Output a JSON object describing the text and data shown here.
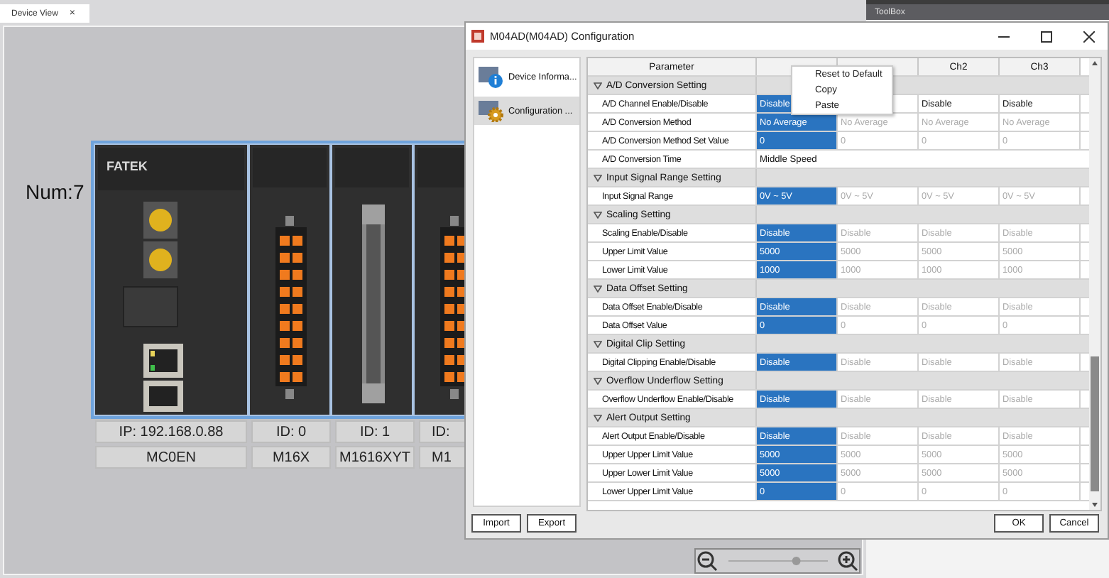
{
  "document_tab": {
    "label": "Device View",
    "close": "×"
  },
  "toolbox": {
    "title": "ToolBox"
  },
  "zoom": {
    "level": 0.7
  },
  "canvas": {
    "count_label": "Num:7",
    "modules": [
      {
        "kind": "cpu",
        "logo": "FATEK",
        "address": "IP: 192.168.0.88",
        "name": "MC0EN"
      },
      {
        "kind": "terminal",
        "address": "ID:  0",
        "name": "M16X"
      },
      {
        "kind": "connector",
        "address": "ID:  1",
        "name": "M1616XYT"
      },
      {
        "kind": "terminal",
        "address": "ID:",
        "name": "M1"
      }
    ]
  },
  "dialog": {
    "title": "M04AD(M04AD) Configuration",
    "nav": [
      {
        "label": "Device Informa...",
        "selected": false
      },
      {
        "label": "Configuration ...",
        "selected": true
      }
    ],
    "columns": [
      {
        "label": "Parameter"
      },
      {},
      {},
      {
        "label": "Ch2"
      },
      {
        "label": "Ch3"
      }
    ],
    "rows": [
      {
        "kind": "section",
        "label": "A/D Conversion Setting",
        "expanded": true
      },
      {
        "kind": "param",
        "label": "A/D Channel Enable/Disable",
        "cells": [
          {
            "text": "Disable",
            "selected": true,
            "disabled": false
          },
          {
            "selected": false
          },
          {
            "text": "Disable",
            "selected": false,
            "disabled": false
          },
          {
            "text": "Disable",
            "selected": false,
            "disabled": false
          }
        ]
      },
      {
        "kind": "param",
        "label": "A/D Conversion Method",
        "cells": [
          {
            "text": "No Average",
            "selected": true,
            "disabled": false
          },
          {
            "text": "No Average",
            "selected": false,
            "disabled": true
          },
          {
            "text": "No Average",
            "selected": false,
            "disabled": true
          },
          {
            "text": "No Average",
            "selected": false,
            "disabled": true
          }
        ]
      },
      {
        "kind": "param",
        "label": "A/D Conversion Method Set Value",
        "cells": [
          {
            "text": "0",
            "selected": true,
            "disabled": false
          },
          {
            "text": "0",
            "selected": false,
            "disabled": true
          },
          {
            "text": "0",
            "selected": false,
            "disabled": true
          },
          {
            "text": "0",
            "selected": false,
            "disabled": true
          }
        ]
      },
      {
        "kind": "span",
        "label": "A/D Conversion Time",
        "value": "Middle Speed"
      },
      {
        "kind": "section",
        "label": "Input Signal Range Setting",
        "expanded": true
      },
      {
        "kind": "param",
        "label": "Input Signal Range",
        "cells": [
          {
            "text": "0V ~ 5V",
            "selected": true,
            "disabled": false
          },
          {
            "text": "0V ~ 5V",
            "selected": false,
            "disabled": true
          },
          {
            "text": "0V ~ 5V",
            "selected": false,
            "disabled": true
          },
          {
            "text": "0V ~ 5V",
            "selected": false,
            "disabled": true
          }
        ]
      },
      {
        "kind": "section",
        "label": "Scaling Setting",
        "expanded": true
      },
      {
        "kind": "param",
        "label": "Scaling Enable/Disable",
        "cells": [
          {
            "text": "Disable",
            "selected": true,
            "disabled": false
          },
          {
            "text": "Disable",
            "selected": false,
            "disabled": true
          },
          {
            "text": "Disable",
            "selected": false,
            "disabled": true
          },
          {
            "text": "Disable",
            "selected": false,
            "disabled": true
          }
        ]
      },
      {
        "kind": "param",
        "label": "Upper Limit Value",
        "cells": [
          {
            "text": "5000",
            "selected": true,
            "disabled": false
          },
          {
            "text": "5000",
            "selected": false,
            "disabled": true
          },
          {
            "text": "5000",
            "selected": false,
            "disabled": true
          },
          {
            "text": "5000",
            "selected": false,
            "disabled": true
          }
        ]
      },
      {
        "kind": "param",
        "label": "Lower Limit Value",
        "cells": [
          {
            "text": "1000",
            "selected": true,
            "disabled": false
          },
          {
            "text": "1000",
            "selected": false,
            "disabled": true
          },
          {
            "text": "1000",
            "selected": false,
            "disabled": true
          },
          {
            "text": "1000",
            "selected": false,
            "disabled": true
          }
        ]
      },
      {
        "kind": "section",
        "label": "Data Offset Setting",
        "expanded": true
      },
      {
        "kind": "param",
        "label": "Data Offset Enable/Disable",
        "cells": [
          {
            "text": "Disable",
            "selected": true,
            "disabled": false
          },
          {
            "text": "Disable",
            "selected": false,
            "disabled": true
          },
          {
            "text": "Disable",
            "selected": false,
            "disabled": true
          },
          {
            "text": "Disable",
            "selected": false,
            "disabled": true
          }
        ]
      },
      {
        "kind": "param",
        "label": "Data Offset Value",
        "cells": [
          {
            "text": "0",
            "selected": true,
            "disabled": false
          },
          {
            "text": "0",
            "selected": false,
            "disabled": true
          },
          {
            "text": "0",
            "selected": false,
            "disabled": true
          },
          {
            "text": "0",
            "selected": false,
            "disabled": true
          }
        ]
      },
      {
        "kind": "section",
        "label": "Digital Clip Setting",
        "expanded": true
      },
      {
        "kind": "param",
        "label": "Digital Clipping Enable/Disable",
        "cells": [
          {
            "text": "Disable",
            "selected": true,
            "disabled": false
          },
          {
            "text": "Disable",
            "selected": false,
            "disabled": true
          },
          {
            "text": "Disable",
            "selected": false,
            "disabled": true
          },
          {
            "text": "Disable",
            "selected": false,
            "disabled": true
          }
        ]
      },
      {
        "kind": "section",
        "label": "Overflow Underflow Setting",
        "expanded": true
      },
      {
        "kind": "param",
        "label": "Overflow Underflow Enable/Disable",
        "cells": [
          {
            "text": "Disable",
            "selected": true,
            "disabled": false
          },
          {
            "text": "Disable",
            "selected": false,
            "disabled": true
          },
          {
            "text": "Disable",
            "selected": false,
            "disabled": true
          },
          {
            "text": "Disable",
            "selected": false,
            "disabled": true
          }
        ]
      },
      {
        "kind": "section",
        "label": "Alert Output Setting",
        "expanded": true
      },
      {
        "kind": "param",
        "label": "Alert Output Enable/Disable",
        "cells": [
          {
            "text": "Disable",
            "selected": true,
            "disabled": false
          },
          {
            "text": "Disable",
            "selected": false,
            "disabled": true
          },
          {
            "text": "Disable",
            "selected": false,
            "disabled": true
          },
          {
            "text": "Disable",
            "selected": false,
            "disabled": true
          }
        ]
      },
      {
        "kind": "param",
        "label": "Upper Upper Limit Value",
        "cells": [
          {
            "text": "5000",
            "selected": true,
            "disabled": false
          },
          {
            "text": "5000",
            "selected": false,
            "disabled": true
          },
          {
            "text": "5000",
            "selected": false,
            "disabled": true
          },
          {
            "text": "5000",
            "selected": false,
            "disabled": true
          }
        ]
      },
      {
        "kind": "param",
        "label": "Upper Lower Limit Value",
        "cells": [
          {
            "text": "5000",
            "selected": true,
            "disabled": false
          },
          {
            "text": "5000",
            "selected": false,
            "disabled": true
          },
          {
            "text": "5000",
            "selected": false,
            "disabled": true
          },
          {
            "text": "5000",
            "selected": false,
            "disabled": true
          }
        ]
      },
      {
        "kind": "param",
        "label": "Lower Upper Limit Value",
        "cells": [
          {
            "text": "0",
            "selected": true,
            "disabled": false
          },
          {
            "text": "0",
            "selected": false,
            "disabled": true
          },
          {
            "text": "0",
            "selected": false,
            "disabled": true
          },
          {
            "text": "0",
            "selected": false,
            "disabled": true
          }
        ]
      }
    ],
    "context_menu": [
      "Reset to Default",
      "Copy",
      "Paste"
    ],
    "left_buttons": [
      "Import",
      "Export"
    ],
    "right_buttons": [
      "OK",
      "Cancel"
    ]
  }
}
